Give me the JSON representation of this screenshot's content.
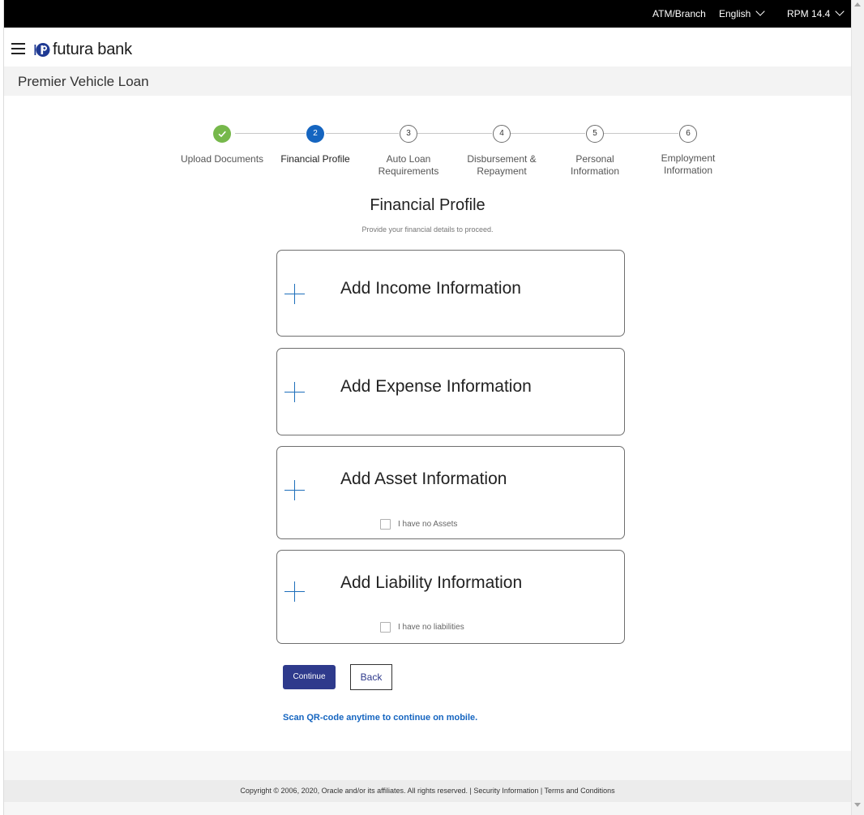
{
  "topbar": {
    "atm_branch": "ATM/Branch",
    "language": "English",
    "version": "RPM 14.4"
  },
  "header": {
    "brand": "futura bank"
  },
  "page": {
    "title": "Premier Vehicle Loan"
  },
  "stepper": {
    "steps": [
      {
        "number": "1",
        "label_1": "Upload Documents",
        "label_2": "",
        "state": "completed"
      },
      {
        "number": "2",
        "label_1": "Financial Profile",
        "label_2": "",
        "state": "active"
      },
      {
        "number": "3",
        "label_1": "Auto Loan",
        "label_2": "Requirements",
        "state": "pending"
      },
      {
        "number": "4",
        "label_1": "Disbursement &",
        "label_2": "Repayment",
        "state": "pending"
      },
      {
        "number": "5",
        "label_1": "Personal",
        "label_2": "Information",
        "state": "pending"
      },
      {
        "number": "6",
        "label_1": "Employment",
        "label_2": "Information",
        "state": "pending"
      }
    ]
  },
  "section": {
    "title": "Financial Profile",
    "subtitle": "Provide your financial details to proceed."
  },
  "cards": {
    "income": {
      "title": "Add Income Information"
    },
    "expense": {
      "title": "Add Expense Information"
    },
    "asset": {
      "title": "Add Asset Information",
      "checkbox_label": "I have no Assets",
      "checked": false
    },
    "liability": {
      "title": "Add Liability Information",
      "checkbox_label": "I have no liabilities",
      "checked": false
    }
  },
  "actions": {
    "continue_label": "Continue",
    "back_label": "Back",
    "qr_link": "Scan QR-code anytime to continue on mobile."
  },
  "footer": {
    "text": "Copyright © 2006, 2020, Oracle and/or its affiliates. All rights reserved. | Security Information | Terms and Conditions"
  },
  "colors": {
    "completed": "#76b84b",
    "active": "#1565c0",
    "primary_button": "#2e3a8c",
    "link": "#1565c0"
  },
  "icons": [
    "menu-icon",
    "logo-icon",
    "chevron-down-icon",
    "check-icon",
    "plus-icon"
  ]
}
